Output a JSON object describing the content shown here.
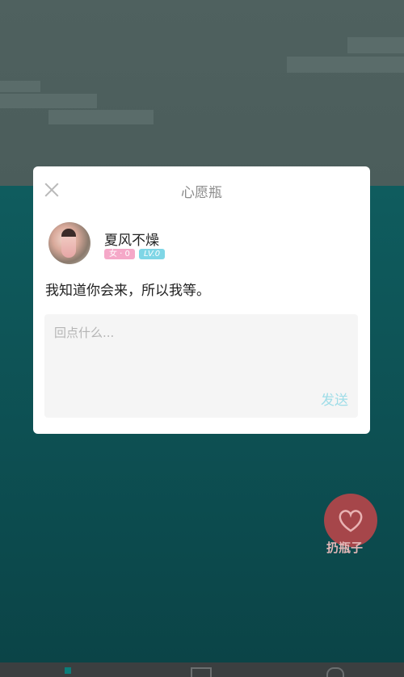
{
  "modal": {
    "title": "心愿瓶",
    "user": {
      "name": "夏风不燥",
      "gender_badge": "女 · 0",
      "level_badge": "LV.0"
    },
    "message": "我知道你会来，所以我等。",
    "reply": {
      "placeholder": "回点什么...",
      "value": "",
      "send_label": "发送"
    }
  },
  "floating_action": {
    "label": "扔瓶子",
    "icon": "heart-icon"
  },
  "colors": {
    "sea": "#0d5558",
    "sky": "#4d5f5d",
    "throw_button": "#a6464a",
    "send": "#9fdde8"
  }
}
